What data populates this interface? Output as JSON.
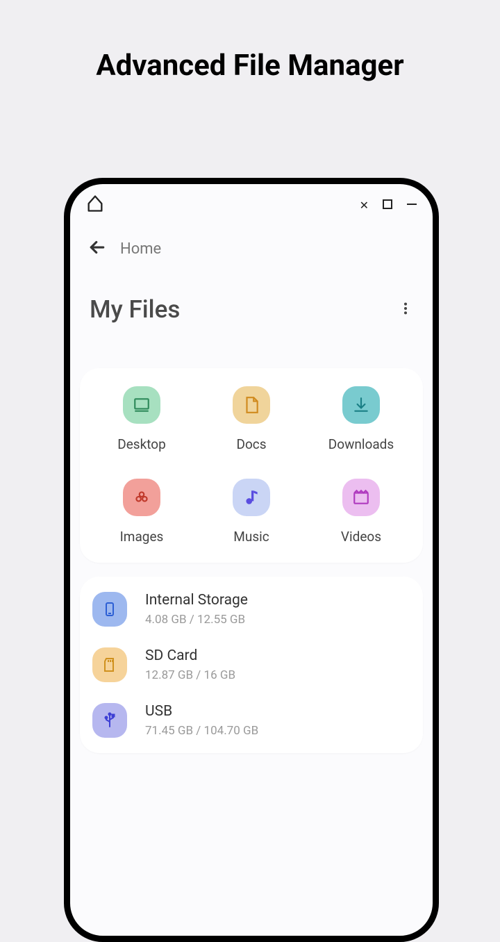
{
  "promo": {
    "title": "Advanced File Manager"
  },
  "nav": {
    "breadcrumb": "Home"
  },
  "header": {
    "title": "My Files"
  },
  "categories": [
    {
      "label": "Desktop"
    },
    {
      "label": "Docs"
    },
    {
      "label": "Downloads"
    },
    {
      "label": "Images"
    },
    {
      "label": "Music"
    },
    {
      "label": "Videos"
    }
  ],
  "storage": [
    {
      "title": "Internal Storage",
      "sub": "4.08 GB / 12.55 GB"
    },
    {
      "title": "SD Card",
      "sub": "12.87 GB / 16 GB"
    },
    {
      "title": "USB",
      "sub": "71.45 GB / 104.70 GB"
    }
  ]
}
